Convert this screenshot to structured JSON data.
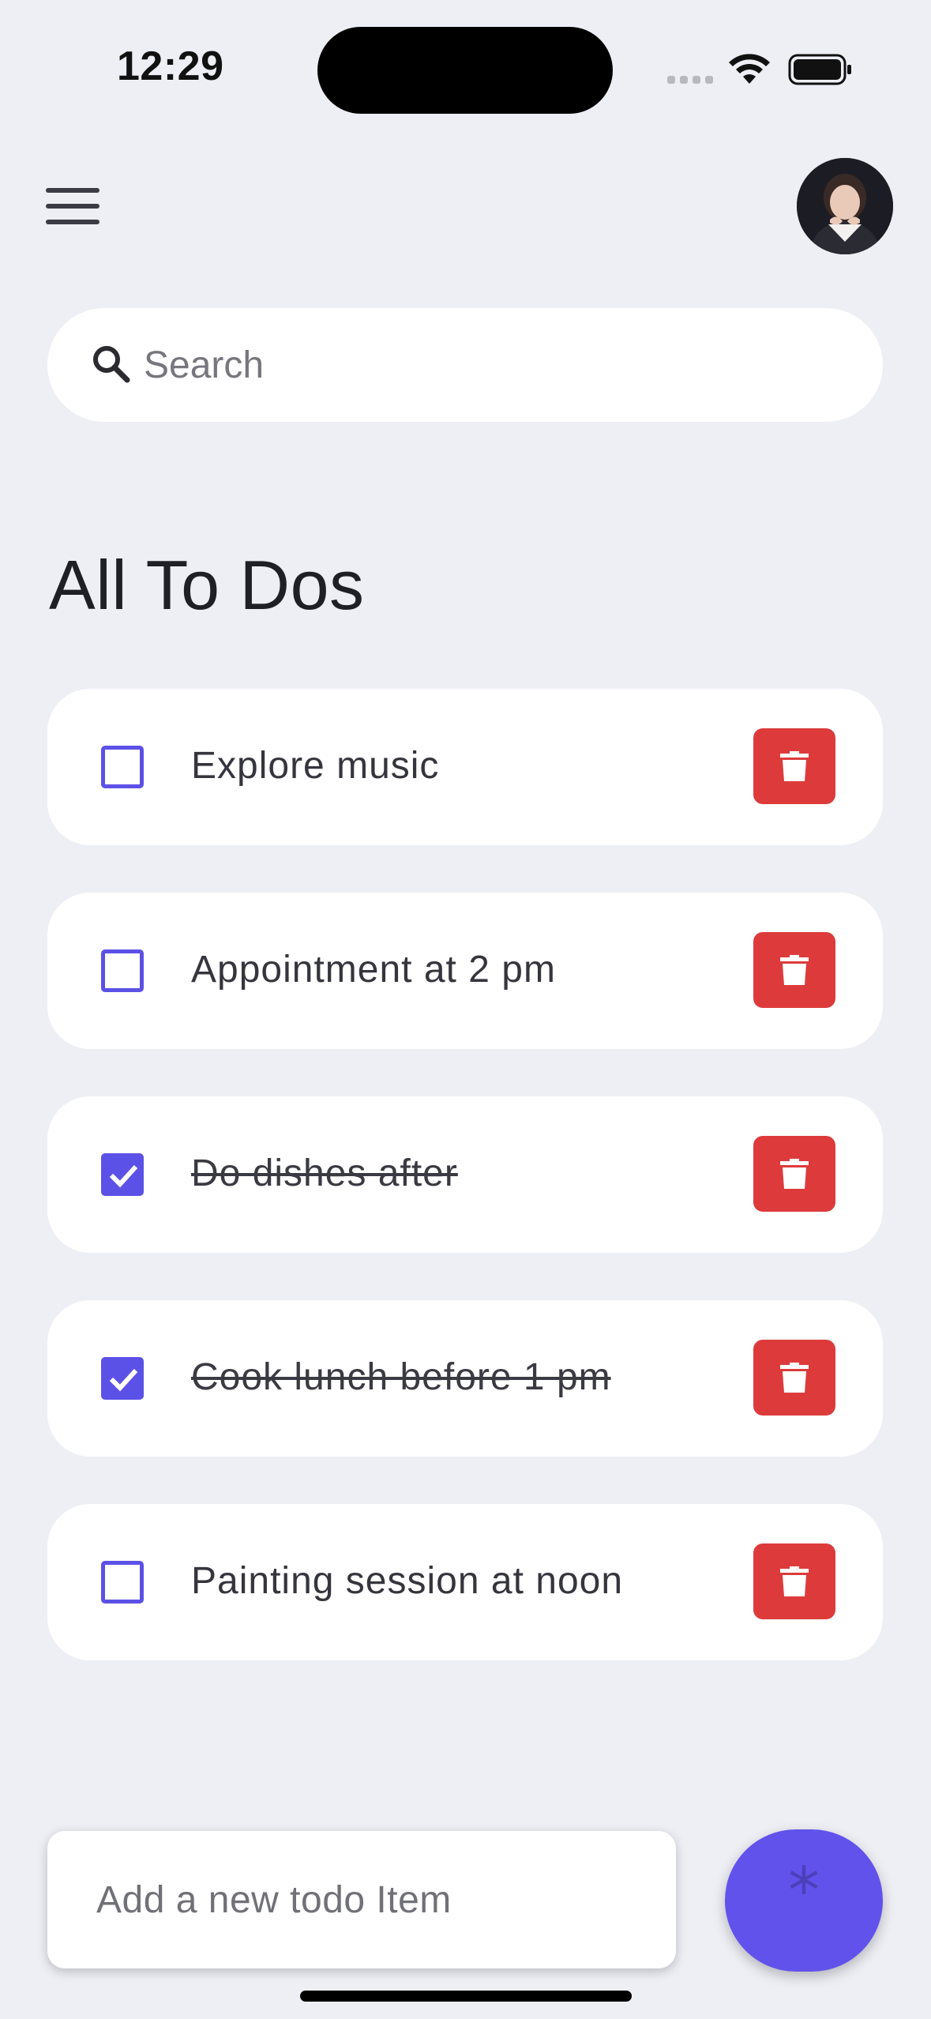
{
  "status_bar": {
    "time": "12:29"
  },
  "search": {
    "placeholder": "Search"
  },
  "page": {
    "title": "All To Dos"
  },
  "todos": [
    {
      "text": "Explore music",
      "done": false
    },
    {
      "text": "Appointment at 2 pm",
      "done": false
    },
    {
      "text": "Do dishes after",
      "done": true
    },
    {
      "text": "Cook lunch before 1 pm",
      "done": true
    },
    {
      "text": "Painting session at noon",
      "done": false
    }
  ],
  "add_todo": {
    "placeholder": "Add a new todo Item",
    "button_glyph": "*"
  },
  "colors": {
    "background": "#eeeff5",
    "accent": "#5c51e6",
    "delete": "#dd3b3b",
    "fab": "#6152ec"
  },
  "icons": {
    "menu": "hamburger-icon",
    "search": "search-icon",
    "delete": "trash-icon",
    "checked": "checkmark-icon"
  }
}
